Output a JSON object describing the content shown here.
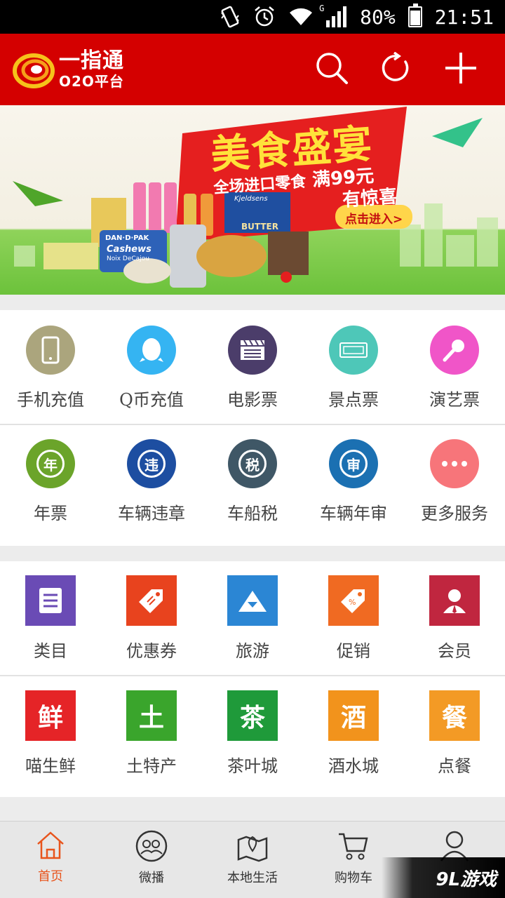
{
  "status_bar": {
    "network": "G",
    "battery": "80%",
    "battery_level": 0.8,
    "time": "21:51",
    "icons": [
      "vibrate-icon",
      "alarm-icon",
      "wifi-icon",
      "signal-icon",
      "battery-icon"
    ]
  },
  "header": {
    "brand_title": "一指通",
    "brand_sub": "O2O平台",
    "actions": [
      "search-icon",
      "refresh-icon",
      "add-icon"
    ],
    "bg_color": "#d40000"
  },
  "banner": {
    "headline": "美食盛宴",
    "line1": "全场进口零食",
    "line1b": "满99元",
    "line2": "有惊喜",
    "cta": "点击进入>",
    "product_a": "DAN·D·PAK",
    "product_b": "Cashews",
    "product_c": "Noix DeCajou",
    "product_d": "Kjeldsens",
    "product_e": "BUTTER"
  },
  "services": {
    "row1": [
      {
        "label": "手机充值",
        "icon": "phone-icon",
        "color": "#aba57d"
      },
      {
        "label": "Q币充值",
        "icon": "qq-penguin-icon",
        "color": "#35b4f2"
      },
      {
        "label": "电影票",
        "icon": "clapperboard-icon",
        "color": "#4b3d6a"
      },
      {
        "label": "景点票",
        "icon": "ticket-icon",
        "color": "#4ec7b8"
      },
      {
        "label": "演艺票",
        "icon": "microphone-icon",
        "color": "#f055c8"
      }
    ],
    "row2": [
      {
        "label": "年票",
        "icon": "year-icon",
        "glyph": "年",
        "color": "#6ba42a"
      },
      {
        "label": "车辆违章",
        "icon": "violation-icon",
        "glyph": "违",
        "color": "#1d4ea1"
      },
      {
        "label": "车船税",
        "icon": "tax-icon",
        "glyph": "税",
        "color": "#3f5766"
      },
      {
        "label": "车辆年审",
        "icon": "inspection-icon",
        "glyph": "审",
        "color": "#1b70b2"
      },
      {
        "label": "更多服务",
        "icon": "more-icon",
        "color": "#f7757a"
      }
    ]
  },
  "shop": {
    "row1": [
      {
        "label": "类目",
        "icon": "category-icon",
        "color": "#6a4bb5"
      },
      {
        "label": "优惠券",
        "icon": "coupon-icon",
        "color": "#e8431e"
      },
      {
        "label": "旅游",
        "icon": "travel-icon",
        "color": "#2b86d4"
      },
      {
        "label": "促销",
        "icon": "promotion-icon",
        "color": "#f06a22"
      },
      {
        "label": "会员",
        "icon": "member-icon",
        "color": "#c0263f"
      }
    ],
    "row2": [
      {
        "label": "喵生鲜",
        "icon": "fresh-icon",
        "glyph": "鲜",
        "color": "#e52427"
      },
      {
        "label": "土特产",
        "icon": "local-product-icon",
        "glyph": "土",
        "color": "#3aa52c"
      },
      {
        "label": "茶叶城",
        "icon": "tea-icon",
        "glyph": "茶",
        "color": "#1f9a3a"
      },
      {
        "label": "酒水城",
        "icon": "liquor-icon",
        "glyph": "酒",
        "color": "#f2931c"
      },
      {
        "label": "点餐",
        "icon": "order-food-icon",
        "glyph": "餐",
        "color": "#f39a25"
      }
    ]
  },
  "bottom_nav": [
    {
      "label": "首页",
      "icon": "home-icon",
      "active": true
    },
    {
      "label": "微播",
      "icon": "weibo-broadcast-icon",
      "active": false
    },
    {
      "label": "本地生活",
      "icon": "map-icon",
      "active": false
    },
    {
      "label": "购物车",
      "icon": "cart-icon",
      "active": false
    },
    {
      "label": "",
      "icon": "user-icon",
      "active": false
    }
  ],
  "watermark": "9L游戏",
  "accent_color": "#e8541c"
}
